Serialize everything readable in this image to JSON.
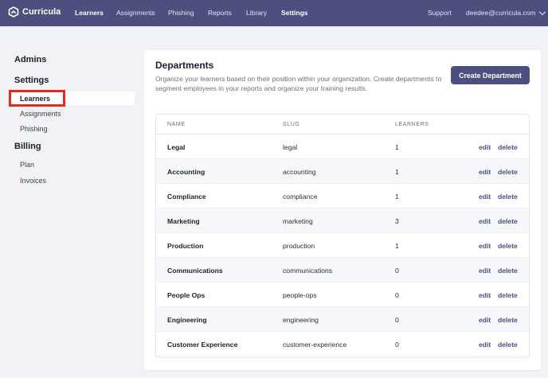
{
  "brand": {
    "name": "Curricula",
    "icon": "curricula-logo-icon"
  },
  "nav": {
    "items": [
      {
        "label": "Learners",
        "active": true
      },
      {
        "label": "Assignments",
        "active": false
      },
      {
        "label": "Phishing",
        "active": false
      },
      {
        "label": "Reports",
        "active": false
      },
      {
        "label": "Library",
        "active": false
      },
      {
        "label": "Settings",
        "active": true
      }
    ],
    "support": "Support",
    "user_email": "deedee@curricula.com"
  },
  "sidebar": {
    "admins": "Admins",
    "settings": "Settings",
    "settings_items": [
      "Learners",
      "Assignments",
      "Phishing"
    ],
    "billing": "Billing",
    "billing_items": [
      "Plan",
      "Invoices"
    ],
    "highlight_color": "#e8291c"
  },
  "main": {
    "title": "Departments",
    "description": "Organize your learners based on their position within your organization. Create departments to segment employees in your reports and organize your training results.",
    "create_button": "Create Department",
    "table": {
      "headers": {
        "name": "NAME",
        "slug": "SLUG",
        "learners": "LEARNERS"
      },
      "rows": [
        {
          "name": "Legal",
          "slug": "legal",
          "learners": "1"
        },
        {
          "name": "Accounting",
          "slug": "accounting",
          "learners": "1"
        },
        {
          "name": "Compliance",
          "slug": "compliance",
          "learners": "1"
        },
        {
          "name": "Marketing",
          "slug": "marketing",
          "learners": "3"
        },
        {
          "name": "Production",
          "slug": "production",
          "learners": "1"
        },
        {
          "name": "Communications",
          "slug": "communications",
          "learners": "0"
        },
        {
          "name": "People Ops",
          "slug": "people-ops",
          "learners": "0"
        },
        {
          "name": "Engineering",
          "slug": "engineering",
          "learners": "0"
        },
        {
          "name": "Customer Experience",
          "slug": "customer-experience",
          "learners": "0"
        }
      ],
      "edit_label": "edit",
      "delete_label": "delete"
    }
  },
  "colors": {
    "header_bg": "#4d4f7e",
    "accent": "#4d4f7e",
    "page_bg": "#f1f2f6"
  }
}
